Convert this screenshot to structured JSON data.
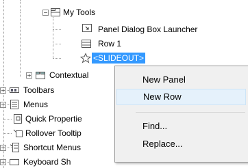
{
  "tree": {
    "my_tools": "My Tools",
    "panel_dialog_box_launcher": "Panel Dialog Box Launcher",
    "row1": "Row 1",
    "slideout": "<SLIDEOUT>",
    "contextual": "Contextual",
    "toolbars": "Toolbars",
    "menus": "Menus",
    "quick_properties": "Quick Propertie",
    "rollover_tooltips": "Rollover Tooltip",
    "shortcut_menus": "Shortcut Menus",
    "keyboard_shortcuts": "Keyboard Sh"
  },
  "context_menu": {
    "new_panel": "New Panel",
    "new_row": "New Row",
    "find": "Find...",
    "replace": "Replace..."
  },
  "colors": {
    "selection": "#3399ff",
    "menu_background": "#f0f0f0",
    "menu_hover": "#e5f1fb"
  }
}
